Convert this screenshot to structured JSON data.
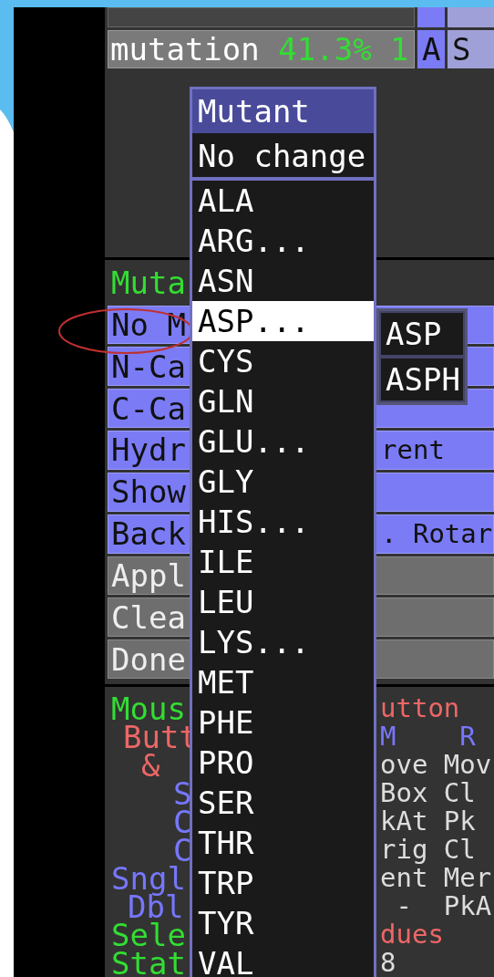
{
  "object_row": {
    "name": "mutation",
    "stats": "41.3% 1",
    "buttons": [
      "A",
      "S"
    ]
  },
  "wizard": {
    "title": "Muta",
    "buttons": [
      {
        "kind": "blue",
        "left": "No M"
      },
      {
        "kind": "blue",
        "left": "N-Ca"
      },
      {
        "kind": "blue",
        "left": "C-Ca"
      },
      {
        "kind": "blue",
        "left": "Hydr",
        "right": "rent"
      },
      {
        "kind": "blue",
        "left": "Show"
      },
      {
        "kind": "blue",
        "left": "Back",
        "right": ". Rotar"
      },
      {
        "kind": "grey",
        "left": "Appl"
      },
      {
        "kind": "grey",
        "left": "Clea"
      },
      {
        "kind": "grey",
        "left": "Done"
      }
    ]
  },
  "mouse_legend": [
    {
      "left": {
        "text": "Mous",
        "color": "#33dd33"
      },
      "right": {
        "text": "utton",
        "color": "#ee6666"
      }
    },
    {
      "left": {
        "text": "Butt",
        "color": "#ee6666"
      },
      "right": {
        "text": "M    R",
        "color": "#7777ff"
      }
    },
    {
      "left": {
        "text": "&",
        "color": "#ee6666"
      },
      "right": {
        "text": "ove Mov",
        "color": "#dddddd"
      }
    },
    {
      "left": {
        "text": "S",
        "color": "#7777ff"
      },
      "right": {
        "text": "Box Cl",
        "color": "#dddddd"
      }
    },
    {
      "left": {
        "text": "C",
        "color": "#7777ff"
      },
      "right": {
        "text": "kAt Pk",
        "color": "#dddddd"
      }
    },
    {
      "left": {
        "text": "C",
        "color": "#7777ff"
      },
      "right": {
        "text": "rig Cl",
        "color": "#dddddd"
      }
    },
    {
      "left": {
        "text": "Sngl",
        "color": "#7777ff"
      },
      "right": {
        "text": "ent Mer",
        "color": "#dddddd"
      }
    },
    {
      "left": {
        "text": "Dbl",
        "color": "#7777ff"
      },
      "right": {
        "text": " -  PkA",
        "color": "#dddddd"
      }
    },
    {
      "left": {
        "text": "Sele",
        "color": "#33dd33"
      },
      "right": {
        "text": "dues",
        "color": "#ee6666"
      }
    },
    {
      "left": {
        "text": "Stat",
        "color": "#33dd33"
      },
      "right": {
        "text": "8",
        "color": "#dddddd"
      }
    }
  ],
  "mutant_menu": {
    "title": "Mutant",
    "top_item": "No change",
    "items": [
      {
        "label": "ALA",
        "selected": false
      },
      {
        "label": "ARG...",
        "selected": false
      },
      {
        "label": "ASN",
        "selected": false
      },
      {
        "label": "ASP...",
        "selected": true
      },
      {
        "label": "CYS",
        "selected": false
      },
      {
        "label": "GLN",
        "selected": false
      },
      {
        "label": "GLU...",
        "selected": false
      },
      {
        "label": "GLY",
        "selected": false
      },
      {
        "label": "HIS...",
        "selected": false
      },
      {
        "label": "ILE",
        "selected": false
      },
      {
        "label": "LEU",
        "selected": false
      },
      {
        "label": "LYS...",
        "selected": false
      },
      {
        "label": "MET",
        "selected": false
      },
      {
        "label": "PHE",
        "selected": false
      },
      {
        "label": "PRO",
        "selected": false
      },
      {
        "label": "SER",
        "selected": false
      },
      {
        "label": "THR",
        "selected": false
      },
      {
        "label": "TRP",
        "selected": false
      },
      {
        "label": "TYR",
        "selected": false
      },
      {
        "label": "VAL",
        "selected": false
      }
    ]
  },
  "submenu": {
    "items": [
      "ASP",
      "ASPH"
    ]
  }
}
